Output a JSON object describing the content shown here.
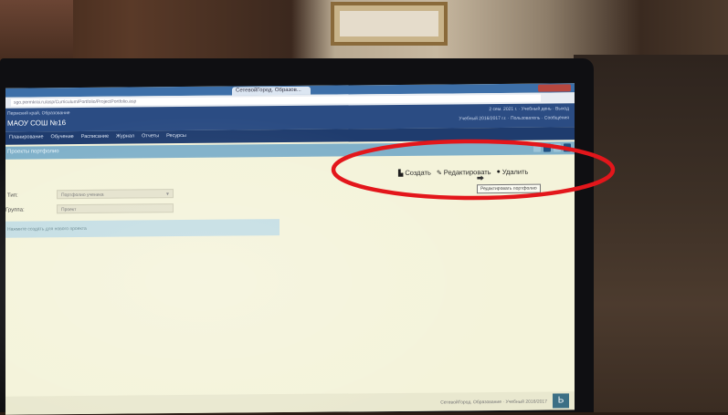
{
  "browser": {
    "tab_title": "СетевойГород. Образов...",
    "address": "sgo.permkrai.ru/asp/Curriculum/Portfolio/ProjectPortfolio.asp"
  },
  "header": {
    "org_name": "Пермский край, Образование",
    "school_name": "МАОУ СОШ №16",
    "right_line_1": "2 сем. 2021 г. · Учебный день · Выход",
    "right_line_2": "Учебный 2016/2017 г.г. · Пользователь · Сообщения"
  },
  "nav": {
    "items": [
      "Планирование",
      "Обучение",
      "Расписание",
      "Журнал",
      "Отчеты",
      "Ресурсы"
    ]
  },
  "page": {
    "title": "Проекты портфолио"
  },
  "toolbar": {
    "create_label": "Создать",
    "edit_label": "Редактировать",
    "delete_label": "Удалить",
    "tooltip": "Редактировать портфолио"
  },
  "form": {
    "label_1": "Тип:",
    "select_value": "Портфолио ученика",
    "label_2": "Группа:",
    "input_value": "Проект"
  },
  "info": {
    "text": "Нажмите создать для нового проекта"
  },
  "status": {
    "text": "СетевойГород. Образование · Учебный 2016/2017",
    "logo": "Ь"
  },
  "colors": {
    "annotation": "#e3161b",
    "header": "#2b4c83",
    "nav": "#1f3c6e",
    "title_bar": "#7fb0c9",
    "screen_bg": "#f4f3da"
  }
}
